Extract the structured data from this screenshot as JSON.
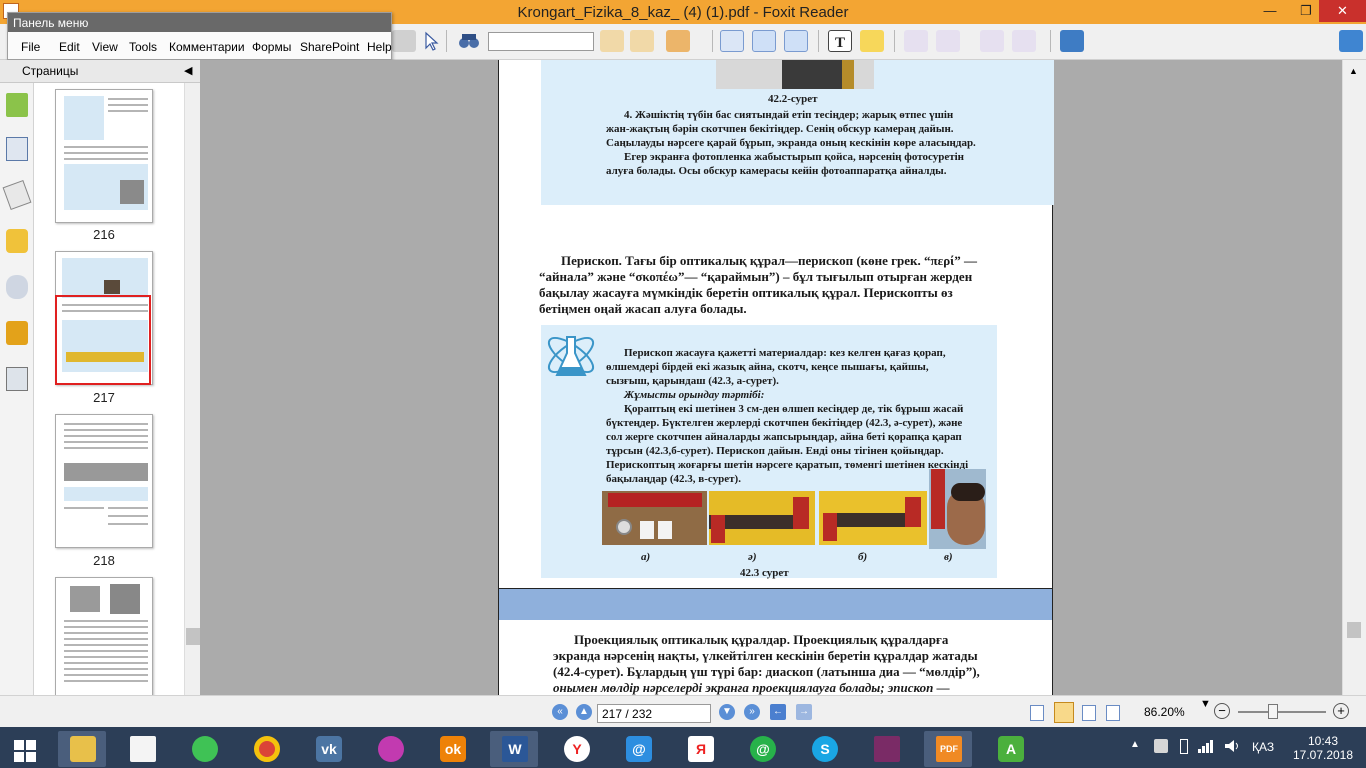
{
  "window": {
    "title": "Krongart_Fizika_8_kaz_ (4) (1).pdf - Foxit Reader",
    "minimize": "—",
    "restore": "❐",
    "close": "✕"
  },
  "menu_panel": {
    "header": "Панель меню",
    "items": [
      "File",
      "Edit",
      "View",
      "Tools",
      "Комментарии",
      "Формы",
      "SharePoint",
      "Help"
    ]
  },
  "sidebar": {
    "title": "Страницы",
    "collapse_icon": "◀",
    "thumbnails": [
      {
        "label": "216"
      },
      {
        "label": "217"
      },
      {
        "label": "218"
      }
    ]
  },
  "document": {
    "fig_42_2_caption": "42.2-сурет",
    "step4_lines": [
      "4. Жәшіктің түбін бас сиятындай етіп тесіңдер; жарық өтпес үшін",
      "жан-жақтың бәрін скотчпен бекітіңдер. Сенің обскур камераң дайын.",
      "Саңылауды нәрсеге қарай бұрып, экранда оның кескінін көре аласыңдар.",
      "Егер экранға фотопленка жабыстырып қойса, нәрсенің фотосуретін",
      "алуға болады. Осы обскур камерасы кейін фотоаппаратқа айналды."
    ],
    "periscope_paragraph": [
      "Перископ. Тағы бір оптикалық құрал—перископ (көне грек. “περί” —",
      "“айнала” және “σκοπέω”— “қараймын”) – бұл тығылып отырған жерден",
      "бақылау жасауға мүмкіндік беретін оптикалық құрал. Перископты өз",
      "бетіңмен оңай жасап алуға болады."
    ],
    "experiment_lines": [
      "Перископ жасауға қажетті материалдар: кез келген қағаз қорап,",
      "өлшемдері бірдей екі жазық айна, скотч, кеңсе пышағы, қайшы,",
      "сызғыш, қарындаш (42.3, а-сурет).",
      "Жұмысты орындау тәртібі:",
      "Қораптың екі шетінен 3 см-ден өлшеп кесіңдер де, тік бұрыш жасай",
      "бүктеңдер. Бүктелген жерлерді скотчпен бекітіңдер (42.3, ә-сурет), және",
      "сол жерге скотчпен айналарды жапсырыңдар, айна беті қорапқа қарап",
      "тұрсын (42.3,б-сурет). Перископ дайын. Енді оны тігінен қойыңдар.",
      "Перископтың жоғарғы шетін нәрсеге қаратып, төменгі шетінен кескінді",
      "бақылаңдар (42.3, в-сурет)."
    ],
    "photo_labels": [
      "а)",
      "ә)",
      "б)",
      "в)"
    ],
    "fig_42_3_caption": "42.3 сурет",
    "page_number": "217",
    "next_page_lines": [
      "Проекциялық оптикалық құралдар. Проекциялық құралдарға",
      "экранда нәрсенің нақты, үлкейтілген кескінін беретін құралдар жатады",
      "(42.4-сурет). Бұлардың үш түрі бар: диаскоп (латынша диа — “мөлдір”),",
      "онымен мөлдір нәрселерді экранға проекциялауға болады; эпископ —"
    ]
  },
  "statusbar": {
    "page_field": "217 / 232",
    "zoom": "86.20%",
    "zoom_minus": "−",
    "zoom_plus": "+"
  },
  "taskbar": {
    "language": "ҚАЗ",
    "time": "10:43",
    "date": "17.07.2018"
  }
}
